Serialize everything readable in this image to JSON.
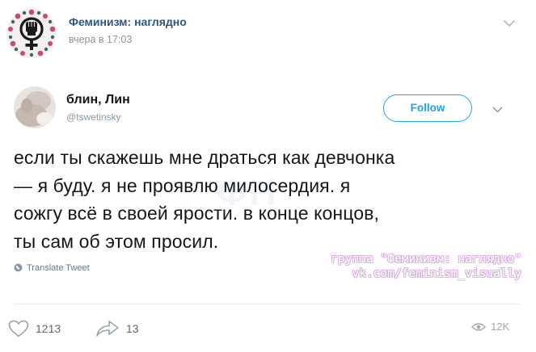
{
  "post": {
    "group_name": "Феминизм: наглядно",
    "date": "вчера в 17:03"
  },
  "tweet": {
    "author_name": "блин, Лин",
    "handle": "@tswetinsky",
    "follow_label": "Follow",
    "text": "если ты скажешь мне драться как девчонка\n— я буду. я не проявлю милосердия. я\nсожгу всё в своей ярости. в конце концов,\nты сам об этом просил.",
    "translate_label": "Translate Tweet"
  },
  "watermark": {
    "line1": "группа \"Феминизм: наглядно\"",
    "line2": "vk.com/feminism_visually"
  },
  "footer": {
    "likes": "1213",
    "shares": "13",
    "views": "12K"
  },
  "colors": {
    "vk_link": "#2a5885",
    "twitter_blue": "#1da1f2",
    "watermark_outline": "#d9b0df",
    "icon_gray": "#a0a8b1"
  },
  "icons": {
    "group_avatar": "raised-fist-emblem",
    "menu": "chevron-down-icon",
    "translate": "globe-icon",
    "like": "heart-icon",
    "share": "share-arrow-icon",
    "views": "eye-icon"
  }
}
